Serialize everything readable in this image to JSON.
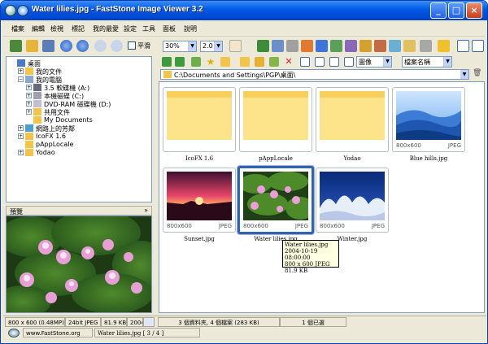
{
  "window": {
    "title": "Water lilies.jpg  -  FastStone Image Viewer 3.2"
  },
  "menu": [
    "檔案",
    "編輯",
    "檢視",
    "標記",
    "我的最愛",
    "設定",
    "工具",
    "面板",
    "說明"
  ],
  "toolbar": {
    "zoom": "30%",
    "ratio": "2.0",
    "smooth_label": "平滑",
    "sort_select": "圖像",
    "sort_by": "檔案名稱"
  },
  "tree": [
    {
      "label": "桌面",
      "icon": "desktop-icon",
      "depth": 0,
      "exp": ""
    },
    {
      "label": "我的文件",
      "icon": "folder-icon",
      "depth": 1,
      "exp": "+"
    },
    {
      "label": "我的電腦",
      "icon": "computer-icon",
      "depth": 1,
      "exp": "−"
    },
    {
      "label": "3.5 軟碟機 (A:)",
      "icon": "floppy-icon",
      "depth": 2,
      "exp": "+"
    },
    {
      "label": "本機磁碟 (C:)",
      "icon": "drive-icon",
      "depth": 2,
      "exp": "+"
    },
    {
      "label": "DVD-RAM 磁碟機 (D:)",
      "icon": "dvd-icon",
      "depth": 2,
      "exp": "+"
    },
    {
      "label": "共用文件",
      "icon": "folder-icon",
      "depth": 2,
      "exp": "+"
    },
    {
      "label": "My Documents",
      "icon": "folder-icon",
      "depth": 2,
      "exp": ""
    },
    {
      "label": "網路上的芳鄰",
      "icon": "network-icon",
      "depth": 1,
      "exp": "+"
    },
    {
      "label": "IcoFX 1.6",
      "icon": "folder-icon",
      "depth": 1,
      "exp": "+"
    },
    {
      "label": "pAppLocale",
      "icon": "folder-icon",
      "depth": 1,
      "exp": ""
    },
    {
      "label": "Yodao",
      "icon": "folder-icon",
      "depth": 1,
      "exp": "+"
    }
  ],
  "preview": {
    "label": "預覽"
  },
  "address": {
    "path": "C:\\Documents and Settings\\PGP\\桌面\\"
  },
  "thumbs": [
    {
      "name": "IcoFX 1.6",
      "type": "folder",
      "meta_size": "",
      "meta_type": ""
    },
    {
      "name": "pAppLocale",
      "type": "folder",
      "meta_size": "",
      "meta_type": ""
    },
    {
      "name": "Yodao",
      "type": "folder",
      "meta_size": "",
      "meta_type": ""
    },
    {
      "name": "Blue hills.jpg",
      "type": "blue",
      "meta_size": "800x600",
      "meta_type": "JPEG"
    },
    {
      "name": "Sunset.jpg",
      "type": "sunset",
      "meta_size": "800x600",
      "meta_type": "JPEG"
    },
    {
      "name": "Water lilies.jpg",
      "type": "lilies",
      "meta_size": "800x600",
      "meta_type": "JPEG"
    },
    {
      "name": "Winter.jpg",
      "type": "winter",
      "meta_size": "800x600",
      "meta_type": "JPEG"
    }
  ],
  "tooltip": [
    "Water lilies.jpg",
    "2004-10-19 08:00:00",
    "800 x 600  JPEG",
    "81.9 KB"
  ],
  "status": {
    "dims": "800 x 600 (0.48MP)",
    "bits": "24bit JPEG",
    "size": "81.9 KB",
    "date": "2004-",
    "counts": "3 個資料夾, 4 個檔案 (283 KB)",
    "selected": "1 個已選",
    "site": "www.FastStone.org",
    "file": "Water lilies.jpg [ 3 / 4 ]"
  },
  "colors": {
    "title_bar": "#0058e6",
    "selection": "#3264b2",
    "tooltip_bg": "#ffffe1"
  }
}
